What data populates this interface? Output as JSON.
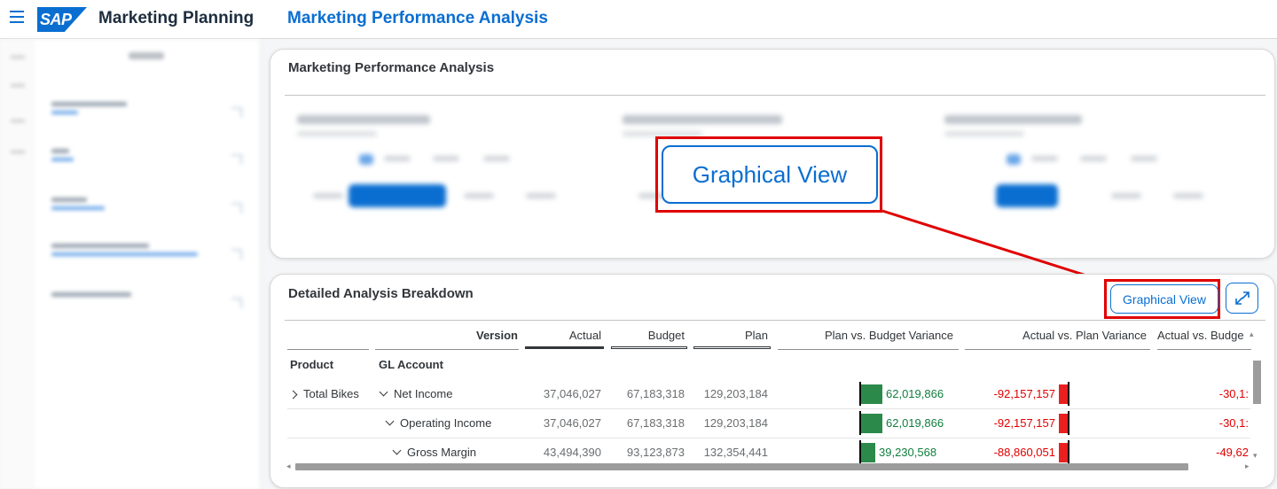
{
  "shell": {
    "app_title": "Marketing Planning",
    "page_title": "Marketing Performance Analysis",
    "logo_text": "SAP"
  },
  "card1": {
    "title": "Marketing Performance Analysis",
    "callout_label": "Graphical View"
  },
  "card2": {
    "title": "Detailed Analysis Breakdown",
    "graphical_view_label": "Graphical View",
    "table": {
      "version_label": "Version",
      "columns": [
        "Actual",
        "Budget",
        "Plan",
        "Plan vs. Budget Variance",
        "Actual vs. Plan Variance",
        "Actual vs. Budge"
      ],
      "dim_product": "Product",
      "dim_gl_account": "GL Account",
      "rows": [
        {
          "product": "Total Bikes",
          "account": "Net Income",
          "actual": "37,046,027",
          "budget": "67,183,318",
          "plan": "129,203,184",
          "pvb": "62,019,866",
          "avp": "-92,157,157",
          "avb": "-30,1:"
        },
        {
          "product": "",
          "account": "Operating Income",
          "actual": "37,046,027",
          "budget": "67,183,318",
          "plan": "129,203,184",
          "pvb": "62,019,866",
          "avp": "-92,157,157",
          "avb": "-30,1:"
        },
        {
          "product": "",
          "account": "Gross Margin",
          "actual": "43,494,390",
          "budget": "93,123,873",
          "plan": "132,354,441",
          "pvb": "39,230,568",
          "avp": "-88,860,051",
          "avb": "-49,62"
        }
      ]
    }
  },
  "colors": {
    "accent": "#0a6ed1",
    "positive": "#107e3e",
    "negative": "#e00000",
    "highlight": "#e00000"
  }
}
